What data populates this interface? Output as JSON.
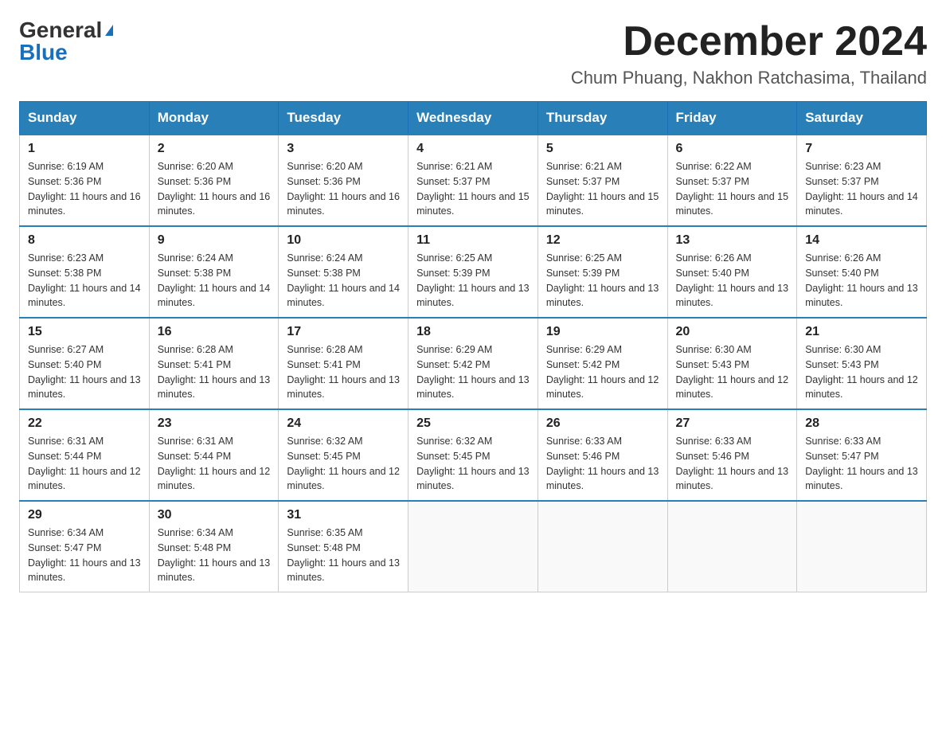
{
  "header": {
    "logo_general": "General",
    "logo_blue": "Blue",
    "month_title": "December 2024",
    "location": "Chum Phuang, Nakhon Ratchasima, Thailand"
  },
  "weekdays": [
    "Sunday",
    "Monday",
    "Tuesday",
    "Wednesday",
    "Thursday",
    "Friday",
    "Saturday"
  ],
  "weeks": [
    [
      {
        "day": "1",
        "sunrise": "6:19 AM",
        "sunset": "5:36 PM",
        "daylight": "11 hours and 16 minutes."
      },
      {
        "day": "2",
        "sunrise": "6:20 AM",
        "sunset": "5:36 PM",
        "daylight": "11 hours and 16 minutes."
      },
      {
        "day": "3",
        "sunrise": "6:20 AM",
        "sunset": "5:36 PM",
        "daylight": "11 hours and 16 minutes."
      },
      {
        "day": "4",
        "sunrise": "6:21 AM",
        "sunset": "5:37 PM",
        "daylight": "11 hours and 15 minutes."
      },
      {
        "day": "5",
        "sunrise": "6:21 AM",
        "sunset": "5:37 PM",
        "daylight": "11 hours and 15 minutes."
      },
      {
        "day": "6",
        "sunrise": "6:22 AM",
        "sunset": "5:37 PM",
        "daylight": "11 hours and 15 minutes."
      },
      {
        "day": "7",
        "sunrise": "6:23 AM",
        "sunset": "5:37 PM",
        "daylight": "11 hours and 14 minutes."
      }
    ],
    [
      {
        "day": "8",
        "sunrise": "6:23 AM",
        "sunset": "5:38 PM",
        "daylight": "11 hours and 14 minutes."
      },
      {
        "day": "9",
        "sunrise": "6:24 AM",
        "sunset": "5:38 PM",
        "daylight": "11 hours and 14 minutes."
      },
      {
        "day": "10",
        "sunrise": "6:24 AM",
        "sunset": "5:38 PM",
        "daylight": "11 hours and 14 minutes."
      },
      {
        "day": "11",
        "sunrise": "6:25 AM",
        "sunset": "5:39 PM",
        "daylight": "11 hours and 13 minutes."
      },
      {
        "day": "12",
        "sunrise": "6:25 AM",
        "sunset": "5:39 PM",
        "daylight": "11 hours and 13 minutes."
      },
      {
        "day": "13",
        "sunrise": "6:26 AM",
        "sunset": "5:40 PM",
        "daylight": "11 hours and 13 minutes."
      },
      {
        "day": "14",
        "sunrise": "6:26 AM",
        "sunset": "5:40 PM",
        "daylight": "11 hours and 13 minutes."
      }
    ],
    [
      {
        "day": "15",
        "sunrise": "6:27 AM",
        "sunset": "5:40 PM",
        "daylight": "11 hours and 13 minutes."
      },
      {
        "day": "16",
        "sunrise": "6:28 AM",
        "sunset": "5:41 PM",
        "daylight": "11 hours and 13 minutes."
      },
      {
        "day": "17",
        "sunrise": "6:28 AM",
        "sunset": "5:41 PM",
        "daylight": "11 hours and 13 minutes."
      },
      {
        "day": "18",
        "sunrise": "6:29 AM",
        "sunset": "5:42 PM",
        "daylight": "11 hours and 13 minutes."
      },
      {
        "day": "19",
        "sunrise": "6:29 AM",
        "sunset": "5:42 PM",
        "daylight": "11 hours and 12 minutes."
      },
      {
        "day": "20",
        "sunrise": "6:30 AM",
        "sunset": "5:43 PM",
        "daylight": "11 hours and 12 minutes."
      },
      {
        "day": "21",
        "sunrise": "6:30 AM",
        "sunset": "5:43 PM",
        "daylight": "11 hours and 12 minutes."
      }
    ],
    [
      {
        "day": "22",
        "sunrise": "6:31 AM",
        "sunset": "5:44 PM",
        "daylight": "11 hours and 12 minutes."
      },
      {
        "day": "23",
        "sunrise": "6:31 AM",
        "sunset": "5:44 PM",
        "daylight": "11 hours and 12 minutes."
      },
      {
        "day": "24",
        "sunrise": "6:32 AM",
        "sunset": "5:45 PM",
        "daylight": "11 hours and 12 minutes."
      },
      {
        "day": "25",
        "sunrise": "6:32 AM",
        "sunset": "5:45 PM",
        "daylight": "11 hours and 13 minutes."
      },
      {
        "day": "26",
        "sunrise": "6:33 AM",
        "sunset": "5:46 PM",
        "daylight": "11 hours and 13 minutes."
      },
      {
        "day": "27",
        "sunrise": "6:33 AM",
        "sunset": "5:46 PM",
        "daylight": "11 hours and 13 minutes."
      },
      {
        "day": "28",
        "sunrise": "6:33 AM",
        "sunset": "5:47 PM",
        "daylight": "11 hours and 13 minutes."
      }
    ],
    [
      {
        "day": "29",
        "sunrise": "6:34 AM",
        "sunset": "5:47 PM",
        "daylight": "11 hours and 13 minutes."
      },
      {
        "day": "30",
        "sunrise": "6:34 AM",
        "sunset": "5:48 PM",
        "daylight": "11 hours and 13 minutes."
      },
      {
        "day": "31",
        "sunrise": "6:35 AM",
        "sunset": "5:48 PM",
        "daylight": "11 hours and 13 minutes."
      },
      null,
      null,
      null,
      null
    ]
  ]
}
